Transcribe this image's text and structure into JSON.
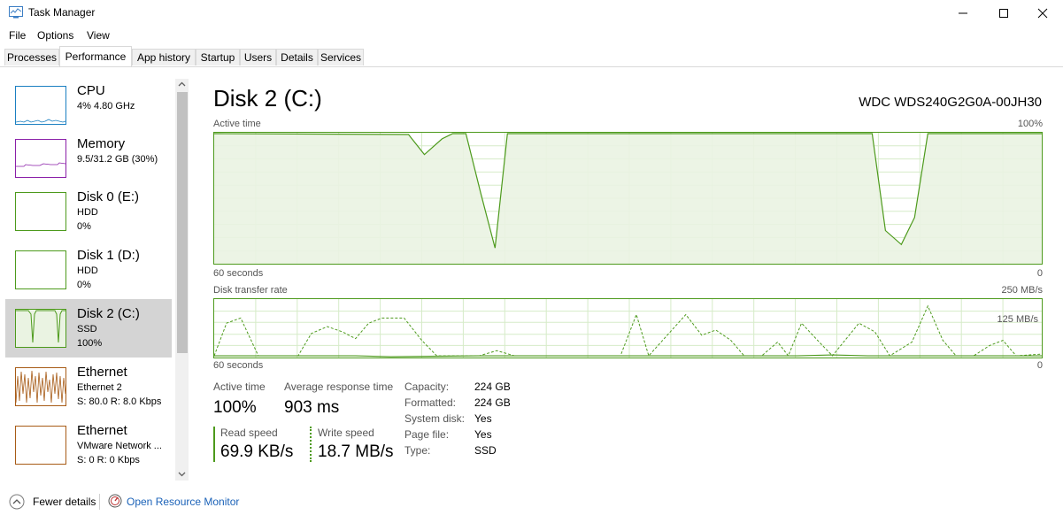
{
  "window": {
    "title": "Task Manager"
  },
  "menu": [
    "File",
    "Options",
    "View"
  ],
  "tabs": [
    "Processes",
    "Performance",
    "App history",
    "Startup",
    "Users",
    "Details",
    "Services"
  ],
  "sidebar": [
    {
      "name": "CPU",
      "line1": "4%  4.80 GHz",
      "line2": "",
      "color": "#1a7fc1"
    },
    {
      "name": "Memory",
      "line1": "9.5/31.2 GB (30%)",
      "line2": "",
      "color": "#8a1fa8"
    },
    {
      "name": "Disk 0 (E:)",
      "line1": "HDD",
      "line2": "0%",
      "color": "#4d9a1c"
    },
    {
      "name": "Disk 1 (D:)",
      "line1": "HDD",
      "line2": "0%",
      "color": "#4d9a1c"
    },
    {
      "name": "Disk 2 (C:)",
      "line1": "SSD",
      "line2": "100%",
      "color": "#4d9a1c"
    },
    {
      "name": "Ethernet",
      "line1": "Ethernet 2",
      "line2": "S: 80.0  R: 8.0 Kbps",
      "color": "#a75b16"
    },
    {
      "name": "Ethernet",
      "line1": "VMware Network ...",
      "line2": "S: 0  R: 0 Kbps",
      "color": "#a75b16"
    }
  ],
  "main": {
    "title": "Disk 2 (C:)",
    "model": "WDC WDS240G2G0A-00JH30",
    "active_graph": {
      "label": "Active time",
      "max": "100%",
      "span": "60 seconds",
      "min": "0"
    },
    "transfer_graph": {
      "label": "Disk transfer rate",
      "max": "250 MB/s",
      "mid": "125 MB/s",
      "span": "60 seconds",
      "min": "0"
    }
  },
  "stats": {
    "active_time": {
      "label": "Active time",
      "value": "100%"
    },
    "avg_response": {
      "label": "Average response time",
      "value": "903 ms"
    },
    "read_speed": {
      "label": "Read speed",
      "value": "69.9 KB/s"
    },
    "write_speed": {
      "label": "Write speed",
      "value": "18.7 MB/s"
    }
  },
  "properties": [
    {
      "label": "Capacity:",
      "value": "224 GB"
    },
    {
      "label": "Formatted:",
      "value": "224 GB"
    },
    {
      "label": "System disk:",
      "value": "Yes"
    },
    {
      "label": "Page file:",
      "value": "Yes"
    },
    {
      "label": "Type:",
      "value": "SSD"
    }
  ],
  "footer": {
    "fewer_details": "Fewer details",
    "resource_monitor": "Open Resource Monitor"
  },
  "colors": {
    "disk": "#4d9a1c",
    "disk_fill": "#eaf3e2",
    "grid": "#d6ebc8",
    "link": "#1b62b8"
  }
}
